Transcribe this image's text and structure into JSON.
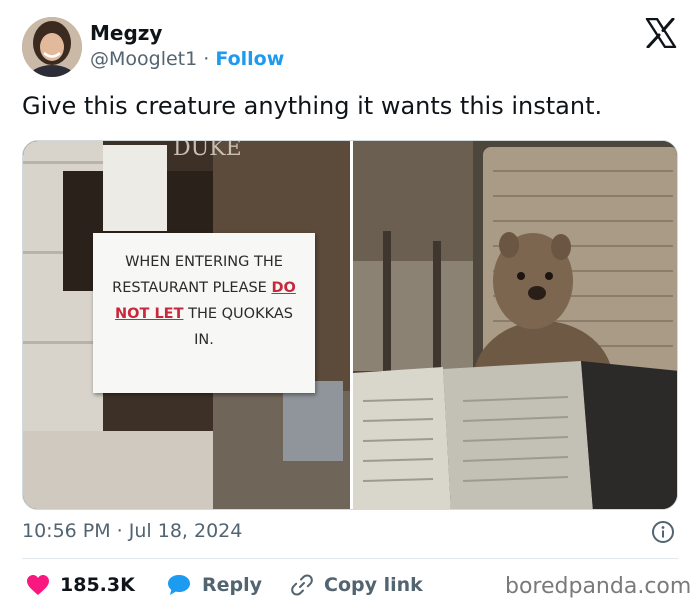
{
  "author": {
    "display_name": "Megzy",
    "handle": "@Mooglet1",
    "separator": "·",
    "follow_label": "Follow"
  },
  "tweet": {
    "text": "Give this creature anything it wants this instant."
  },
  "media": {
    "left_photo": {
      "sign_lines": [
        "WHEN ENTERING THE",
        "RESTAURANT PLEASE",
        "DO",
        "NOT LET",
        "THE QUOKKAS",
        "IN."
      ]
    }
  },
  "meta": {
    "timestamp": "10:56 PM · Jul 18, 2024"
  },
  "actions": {
    "likes_count": "185.3K",
    "reply_label": "Reply",
    "copy_link_label": "Copy link"
  },
  "watermark": "boredpanda.com",
  "colors": {
    "accent": "#1d9bf0",
    "like": "#f91880",
    "reply": "#1d9bf0",
    "text": "#0f1419",
    "muted": "#536471",
    "sign_red": "#c8283c"
  },
  "icons": {
    "brand": "x-logo-icon",
    "info": "info-icon",
    "like": "heart-icon",
    "reply": "speech-bubble-icon",
    "copy": "link-icon"
  }
}
